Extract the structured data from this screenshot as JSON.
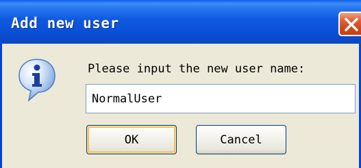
{
  "dialog": {
    "title": "Add new user",
    "prompt": "Please input the new user name:",
    "input_value": "NormalUser",
    "ok_label": "OK",
    "cancel_label": "Cancel",
    "icon": "info-icon",
    "close_icon": "close-icon"
  },
  "colors": {
    "titlebar": "#0a50d6",
    "close_button": "#d04818",
    "face": "#ece9d8"
  }
}
